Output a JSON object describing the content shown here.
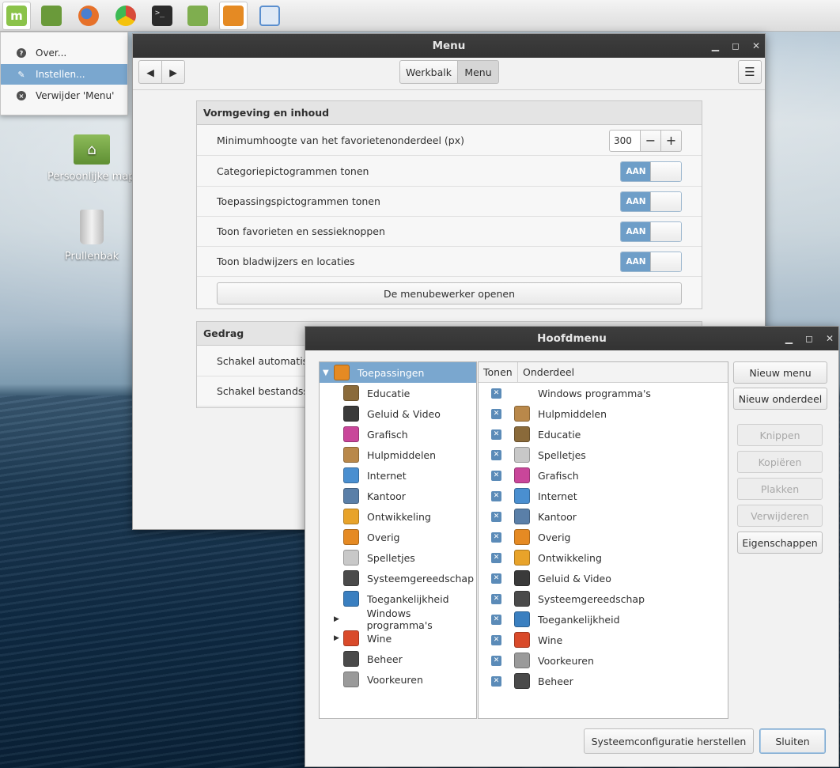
{
  "colors": {
    "accent": "#7aa7cf",
    "switch_on": "#6e9ec8",
    "titlebar": "#3a3a3a"
  },
  "taskbar": {
    "apps": [
      {
        "icon": "mint-menu-icon",
        "color": "#8bc34a"
      },
      {
        "icon": "show-desktop-icon",
        "color": "#6a9a3a"
      },
      {
        "icon": "firefox-icon",
        "color": "#e6712a"
      },
      {
        "icon": "chrome-icon",
        "color": "#d84b3a"
      },
      {
        "icon": "terminal-icon",
        "color": "#2b2b2b"
      },
      {
        "icon": "files-icon",
        "color": "#7fae4f"
      },
      {
        "icon": "cinnamon-icon",
        "color": "#e58a23"
      },
      {
        "icon": "text-editor-icon",
        "color": "#5a8fcf"
      }
    ]
  },
  "context_menu": {
    "items": [
      {
        "label": "Over...",
        "icon": "info-icon"
      },
      {
        "label": "Instellen...",
        "icon": "configure-icon"
      },
      {
        "label": "Verwijder 'Menu'",
        "icon": "remove-icon"
      }
    ]
  },
  "desktop": {
    "home_label": "Persoonlijke map",
    "trash_label": "Prullenbak"
  },
  "settings_window": {
    "title": "Menu",
    "tabs": [
      "Werkbalk",
      "Menu"
    ],
    "section1": {
      "header": "Vormgeving en inhoud",
      "height_label": "Minimumhoogte van het favorietenonderdeel (px)",
      "height_value": "300",
      "switch_label": "AAN",
      "toggles": [
        "Categoriepictogrammen tonen",
        "Toepassingspictogrammen tonen",
        "Toon favorieten en sessieknoppen",
        "Toon bladwijzers en locaties"
      ],
      "editor_button": "De menubewerker openen"
    },
    "section2": {
      "header": "Gedrag",
      "rows": [
        "Schakel automatisch",
        "Schakel bestandssys"
      ]
    }
  },
  "menu_editor": {
    "title": "Hoofdmenu",
    "tree_root": "Toepassingen",
    "tree_items": [
      {
        "label": "Educatie",
        "color": "#8a6a3a"
      },
      {
        "label": "Geluid & Video",
        "color": "#3a3a3a"
      },
      {
        "label": "Grafisch",
        "color": "#c9469a"
      },
      {
        "label": "Hulpmiddelen",
        "color": "#b9884a"
      },
      {
        "label": "Internet",
        "color": "#4a8fd0"
      },
      {
        "label": "Kantoor",
        "color": "#5a7fa8"
      },
      {
        "label": "Ontwikkeling",
        "color": "#e8a32a"
      },
      {
        "label": "Overig",
        "color": "#e58a23"
      },
      {
        "label": "Spelletjes",
        "color": "#c8c8c8"
      },
      {
        "label": "Systeemgereedschap",
        "color": "#4a4a4a"
      },
      {
        "label": "Toegankelijkheid",
        "color": "#3a7fc0"
      },
      {
        "label": "Windows programma's",
        "color": ""
      },
      {
        "label": "Wine",
        "color": "#d94a2a"
      },
      {
        "label": "Beheer",
        "color": "#4a4a4a"
      },
      {
        "label": "Voorkeuren",
        "color": "#9a9a9a"
      }
    ],
    "col_show": "Tonen",
    "col_item": "Onderdeel",
    "list_items": [
      {
        "label": "Windows programma's",
        "color": ""
      },
      {
        "label": "Hulpmiddelen",
        "color": "#b9884a"
      },
      {
        "label": "Educatie",
        "color": "#8a6a3a"
      },
      {
        "label": "Spelletjes",
        "color": "#c8c8c8"
      },
      {
        "label": "Grafisch",
        "color": "#c9469a"
      },
      {
        "label": "Internet",
        "color": "#4a8fd0"
      },
      {
        "label": "Kantoor",
        "color": "#5a7fa8"
      },
      {
        "label": "Overig",
        "color": "#e58a23"
      },
      {
        "label": "Ontwikkeling",
        "color": "#e8a32a"
      },
      {
        "label": "Geluid & Video",
        "color": "#3a3a3a"
      },
      {
        "label": "Systeemgereedschap",
        "color": "#4a4a4a"
      },
      {
        "label": "Toegankelijkheid",
        "color": "#3a7fc0"
      },
      {
        "label": "Wine",
        "color": "#d94a2a"
      },
      {
        "label": "Voorkeuren",
        "color": "#9a9a9a"
      },
      {
        "label": "Beheer",
        "color": "#4a4a4a"
      }
    ],
    "buttons": {
      "new_menu": "Nieuw menu",
      "new_item": "Nieuw onderdeel",
      "cut": "Knippen",
      "copy": "Kopiëren",
      "paste": "Plakken",
      "delete": "Verwijderen",
      "properties": "Eigenschappen",
      "restore": "Systeemconfiguratie herstellen",
      "close": "Sluiten"
    }
  }
}
